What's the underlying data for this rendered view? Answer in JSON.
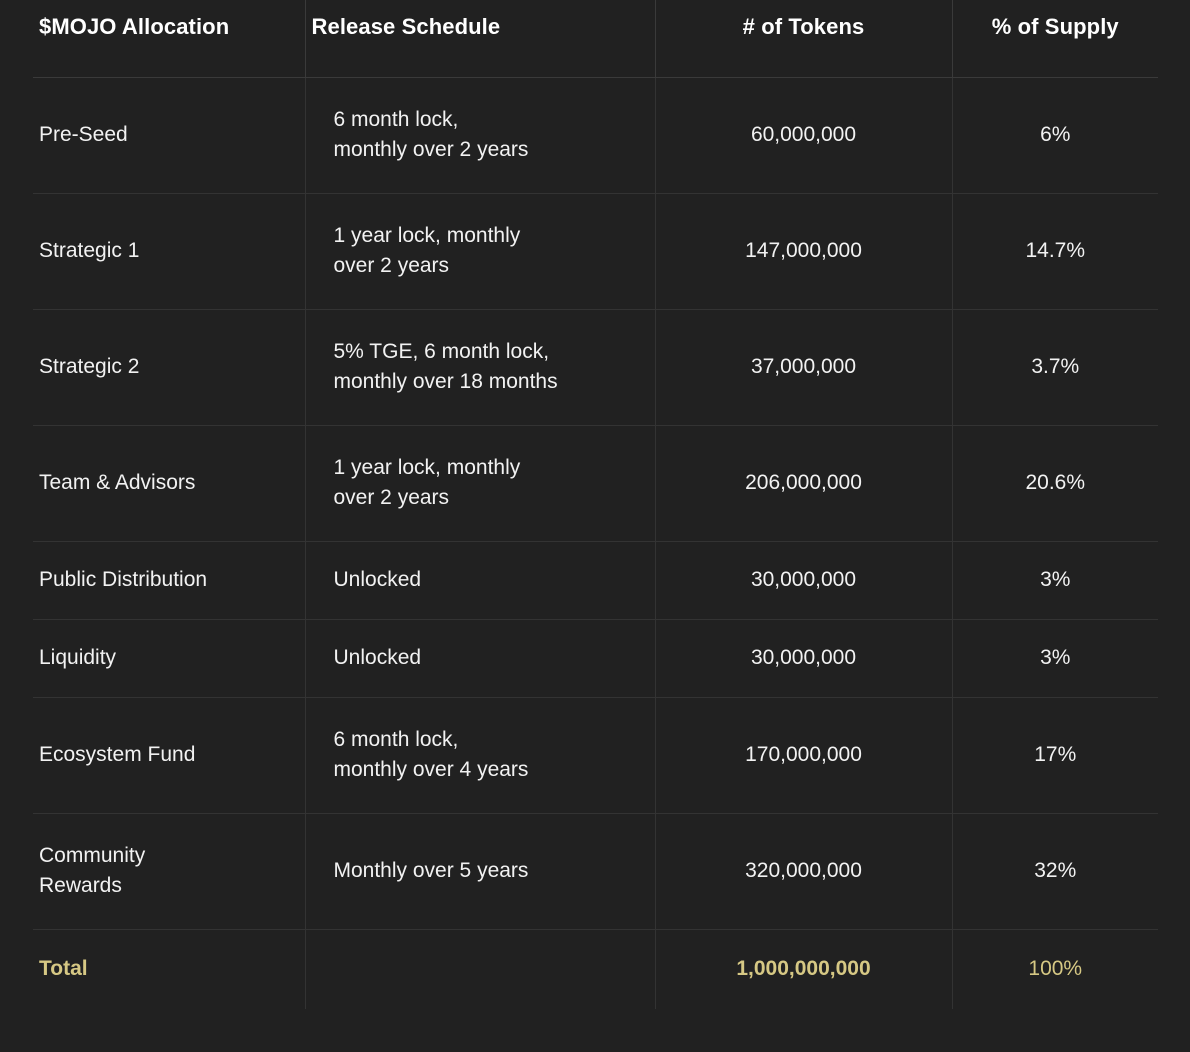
{
  "colors": {
    "background": "#212121",
    "text": "#f2f2f2",
    "header_text": "#ffffff",
    "divider": "#333333",
    "total_accent": "#d6c884"
  },
  "table": {
    "headers": [
      "$MOJO Allocation",
      "Release Schedule",
      "# of Tokens",
      "% of Supply"
    ],
    "rows": [
      {
        "allocation": "Pre-Seed",
        "release_line1": "6 month lock,",
        "release_line2": "monthly over 2 years",
        "tokens": "60,000,000",
        "supply": "6%"
      },
      {
        "allocation": "Strategic 1",
        "release_line1": "1 year lock, monthly",
        "release_line2": "over 2 years",
        "tokens": "147,000,000",
        "supply": "14.7%"
      },
      {
        "allocation": "Strategic 2",
        "release_line1": "5% TGE, 6 month lock,",
        "release_line2": "monthly over 18 months",
        "tokens": "37,000,000",
        "supply": "3.7%"
      },
      {
        "allocation": "Team & Advisors",
        "release_line1": "1 year lock, monthly",
        "release_line2": "over 2 years",
        "tokens": "206,000,000",
        "supply": "20.6%"
      },
      {
        "allocation": "Public Distribution",
        "release_line1": "Unlocked",
        "release_line2": "",
        "tokens": "30,000,000",
        "supply": "3%"
      },
      {
        "allocation": "Liquidity",
        "release_line1": "Unlocked",
        "release_line2": "",
        "tokens": "30,000,000",
        "supply": "3%"
      },
      {
        "allocation": "Ecosystem Fund",
        "release_line1": "6 month lock,",
        "release_line2": "monthly over 4 years",
        "tokens": "170,000,000",
        "supply": "17%"
      },
      {
        "allocation_line1": "Community",
        "allocation_line2": "Rewards",
        "release_line1": "Monthly over 5 years",
        "release_line2": "",
        "tokens": "320,000,000",
        "supply": "32%"
      }
    ],
    "total": {
      "allocation": "Total",
      "release": "",
      "tokens": "1,000,000,000",
      "supply": "100%"
    }
  },
  "chart_data": {
    "type": "table",
    "title": "$MOJO Allocation",
    "columns": [
      "$MOJO Allocation",
      "Release Schedule",
      "# of Tokens",
      "% of Supply"
    ],
    "categories": [
      "Pre-Seed",
      "Strategic 1",
      "Strategic 2",
      "Team & Advisors",
      "Public Distribution",
      "Liquidity",
      "Ecosystem Fund",
      "Community Rewards"
    ],
    "values": [
      60000000,
      147000000,
      37000000,
      206000000,
      30000000,
      30000000,
      170000000,
      320000000
    ],
    "percent_of_supply": [
      6,
      14.7,
      3.7,
      20.6,
      3,
      3,
      17,
      32
    ],
    "total_tokens": 1000000000,
    "total_percent": 100
  }
}
